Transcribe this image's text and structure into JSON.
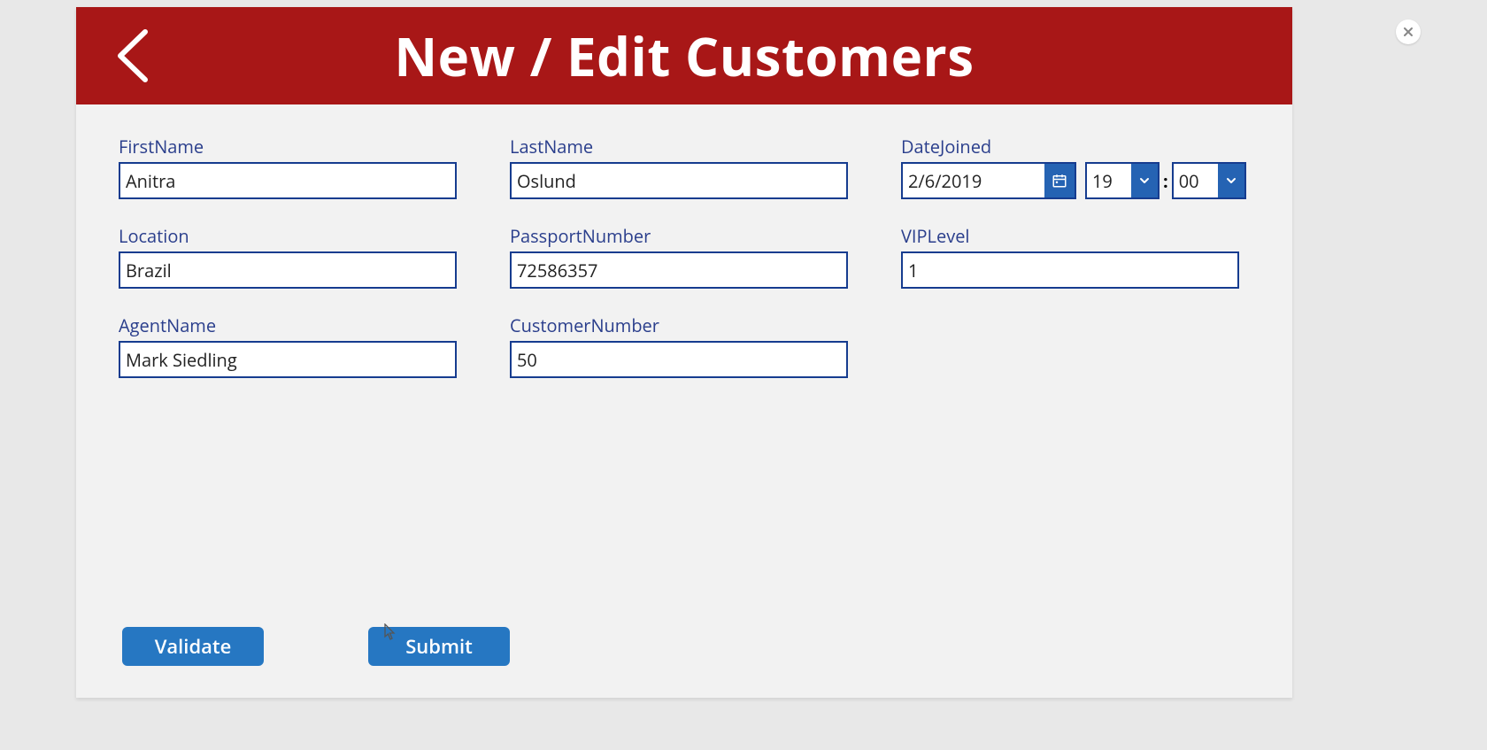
{
  "header": {
    "title": "New / Edit Customers"
  },
  "fields": {
    "firstName": {
      "label": "FirstName",
      "value": "Anitra"
    },
    "lastName": {
      "label": "LastName",
      "value": "Oslund"
    },
    "dateJoined": {
      "label": "DateJoined",
      "date": "2/6/2019",
      "hour": "19",
      "minute": "00"
    },
    "location": {
      "label": "Location",
      "value": "Brazil"
    },
    "passportNumber": {
      "label": "PassportNumber",
      "value": "72586357"
    },
    "vipLevel": {
      "label": "VIPLevel",
      "value": "1"
    },
    "agentName": {
      "label": "AgentName",
      "value": "Mark Siedling"
    },
    "customerNumber": {
      "label": "CustomerNumber",
      "value": "50"
    }
  },
  "buttons": {
    "validate": "Validate",
    "submit": "Submit"
  },
  "timeSeparator": ":"
}
